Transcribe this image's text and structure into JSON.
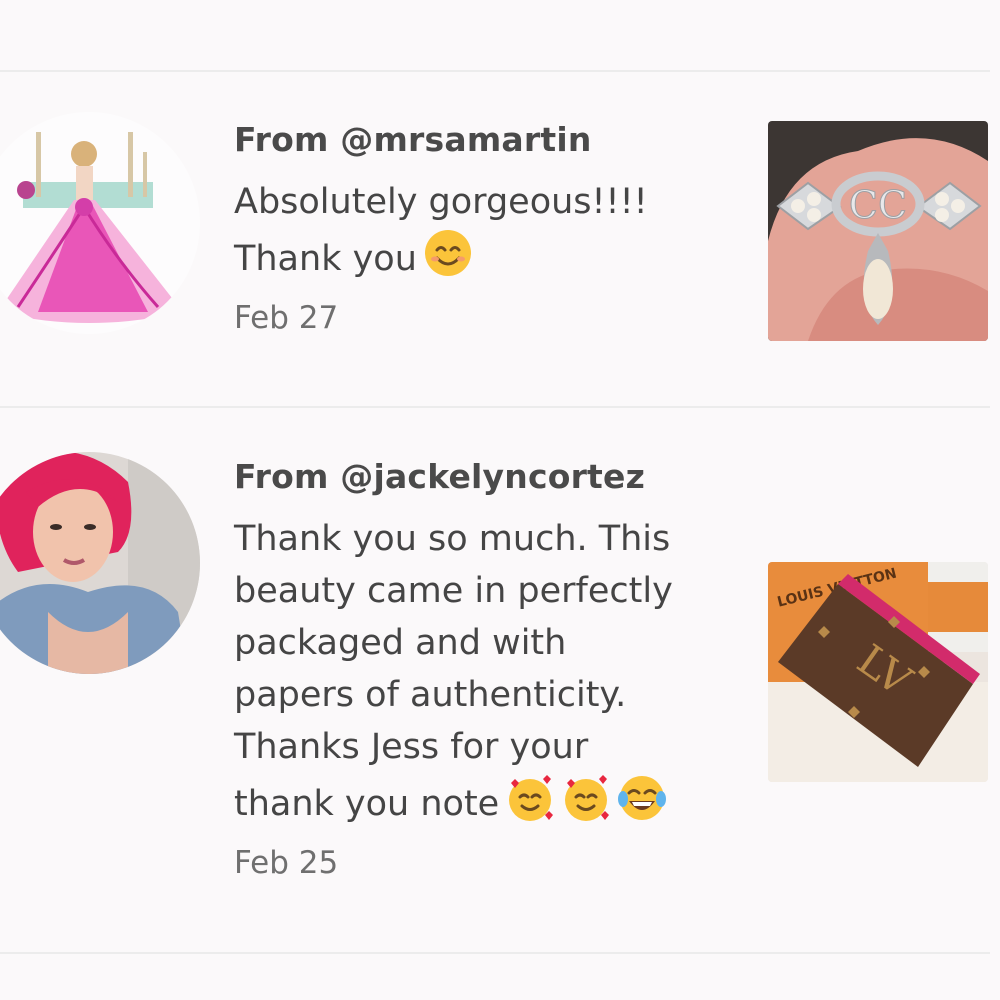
{
  "reviews": [
    {
      "from": "From @mrsamartin",
      "lines": [
        "Absolutely gorgeous!!!!",
        "Thank you"
      ],
      "emojis": [
        "smiling-face-emoji"
      ],
      "date": "Feb 27",
      "avatar": "ballgown-illustration-avatar",
      "item": "pearl-brooch-photo",
      "item_label": "CC"
    },
    {
      "from": "From @jackelyncortez",
      "lines": [
        "Thank you so much. This",
        "beauty came in perfectly",
        "packaged and with",
        "papers of authenticity.",
        "Thanks Jess for your",
        "thank you note"
      ],
      "emojis": [
        "smiling-face-with-hearts-emoji",
        "smiling-face-with-hearts-emoji",
        "tears-of-joy-emoji"
      ],
      "date": "Feb 25",
      "avatar": "pink-hair-woman-avatar",
      "item": "card-holder-photo",
      "item_label": "LOUIS VUITTON"
    }
  ],
  "colors": {
    "background": "#fbf9fa",
    "divider": "#ececec",
    "text": "#454545",
    "date": "#6f6f6f"
  }
}
